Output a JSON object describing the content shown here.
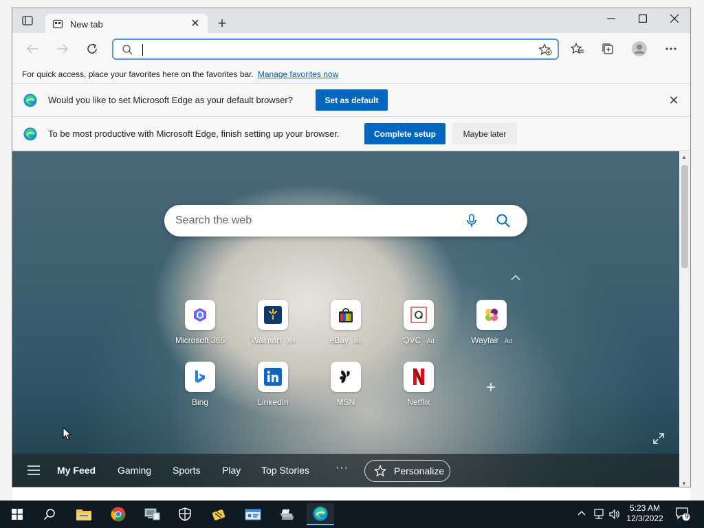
{
  "browser": {
    "tab_title": "New tab",
    "address_value": "",
    "favorites_bar": {
      "text": "For quick access, place your favorites here on the favorites bar.",
      "link": "Manage favorites now"
    },
    "default_prompt": {
      "message": "Would you like to set Microsoft Edge as your default browser?",
      "button": "Set as default"
    },
    "setup_prompt": {
      "message": "To be most productive with Microsoft Edge, finish setting up your browser.",
      "primary_button": "Complete setup",
      "secondary_button": "Maybe later"
    }
  },
  "ntp": {
    "search_placeholder": "Search the web",
    "tiles_row1": [
      {
        "label": "Microsoft 365",
        "ad": ""
      },
      {
        "label": "Walmart",
        "ad": "· Ad"
      },
      {
        "label": "eBay",
        "ad": "· Ad"
      },
      {
        "label": "QVC",
        "ad": "· Ad"
      },
      {
        "label": "Wayfair",
        "ad": "· Ad"
      }
    ],
    "tiles_row2": [
      {
        "label": "Bing"
      },
      {
        "label": "LinkedIn"
      },
      {
        "label": "MSN"
      },
      {
        "label": "Netflix"
      }
    ],
    "feed": {
      "items": [
        "My Feed",
        "Gaming",
        "Sports",
        "Play",
        "Top Stories"
      ],
      "more": "···",
      "personalize": "Personalize"
    }
  },
  "taskbar": {
    "time": "5:23 AM",
    "date": "12/3/2022",
    "notification_count": "9"
  },
  "colors": {
    "accent": "#0067c0",
    "link": "#0b5cad",
    "taskbar": "#0f1a24"
  }
}
